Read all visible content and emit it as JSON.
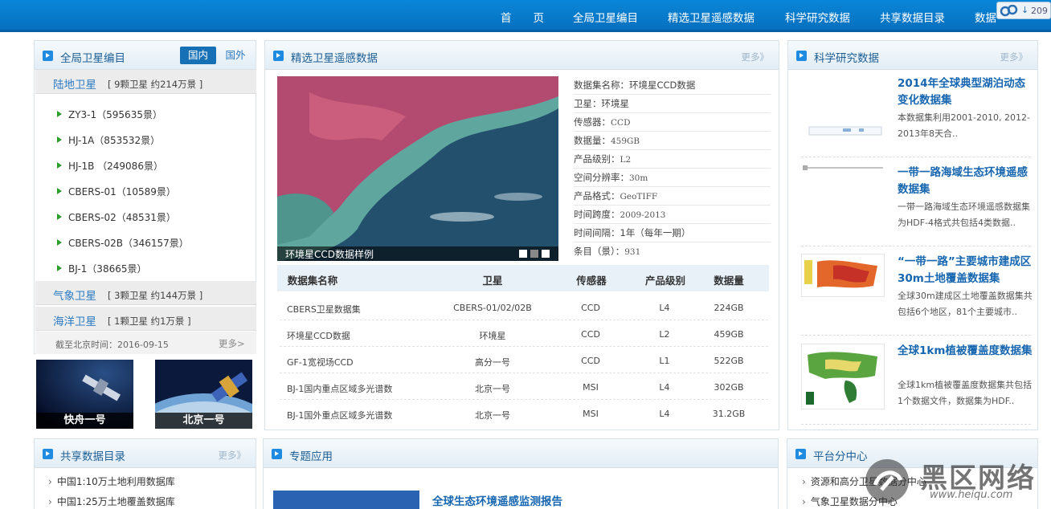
{
  "nav": {
    "items": [
      "首　　页",
      "全局卫星编目",
      "精选卫星遥感数据",
      "科学研究数据",
      "共享数据目录",
      "数据"
    ],
    "counter": "209"
  },
  "global_catalog": {
    "title": "全局卫星编目",
    "tabs": [
      "国内",
      "国外"
    ],
    "land": {
      "name": "陆地卫星",
      "desc": "[ 9颗卫星 约214万景 ]"
    },
    "satellites": [
      "ZY3-1（595635景）",
      "HJ-1A（853532景）",
      "HJ-1B （249086景）",
      "CBERS-01（10589景）",
      "CBERS-02（48531景）",
      "CBERS-02B（346157景）",
      "BJ-1（38665景）"
    ],
    "weather": {
      "name": "气象卫星",
      "desc": "[ 3颗卫星 约144万景 ]"
    },
    "ocean": {
      "name": "海洋卫星",
      "desc": "[ 1颗卫星 约1万景 ]"
    },
    "deadline": "截至北京时间：2016-09-15",
    "more": "更多>"
  },
  "thumbs": [
    "快舟一号",
    "北京一号"
  ],
  "featured": {
    "title": "精选卫星遥感数据",
    "more": "更多》",
    "image_caption": "环境星CCD数据样例",
    "info": [
      [
        "数据集名称：",
        "环境星CCD数据"
      ],
      [
        "卫星：",
        "环境星"
      ],
      [
        "传感器：",
        "CCD"
      ],
      [
        "数据量：",
        "459GB"
      ],
      [
        "产品级别：",
        "L2"
      ],
      [
        "空间分辨率：",
        "30m"
      ],
      [
        "产品格式：",
        "GeoTIFF"
      ],
      [
        "时间跨度：",
        "2009-2013"
      ],
      [
        "时间间隔：",
        "1年（每年一期）"
      ],
      [
        "条目（景）：",
        "931"
      ]
    ],
    "table_headers": [
      "数据集名称",
      "卫星",
      "传感器",
      "产品级别",
      "数据量"
    ],
    "rows": [
      [
        "CBERS卫星数据集",
        "CBERS-01/02/02B",
        "CCD",
        "L4",
        "224GB"
      ],
      [
        "环境星CCD数据",
        "环境星",
        "CCD",
        "L2",
        "459GB"
      ],
      [
        "GF-1宽视场CCD",
        "高分一号",
        "CCD",
        "L1",
        "522GB"
      ],
      [
        "BJ-1国内重点区域多光谱数",
        "北京一号",
        "MSI",
        "L4",
        "302GB"
      ],
      [
        "BJ-1国外重点区域多光谱数",
        "北京一号",
        "MSI",
        "L4",
        "31.2GB"
      ]
    ]
  },
  "science": {
    "title": "科学研究数据",
    "more": "更多》",
    "items": [
      {
        "title": "2014年全球典型湖泊动态变化数据集",
        "desc": "本数据集利用2001-2010, 2012-2013年8天合.."
      },
      {
        "title": "一带一路海域生态环境遥感数据集",
        "desc": "一带一路海域生态环境遥感数据集为HDF-4格式共包括4类数据.."
      },
      {
        "title": "“一带一路”主要城市建成区30m土地覆盖数据集",
        "desc": "全球30m建成区土地覆盖数据集共包括6个地区，81个主要城市.."
      },
      {
        "title": "全球1km植被覆盖度数据集",
        "desc": "全球1km植被覆盖度数据集共包括1个数据文件，数据集为HDF.."
      }
    ]
  },
  "shared": {
    "title": "共享数据目录",
    "more": "更多》",
    "items": [
      "中国1:10万土地利用数据库",
      "中国1:25万土地覆盖数据库"
    ]
  },
  "topic": {
    "title": "专题应用",
    "report": "全球生态环境遥感监测报告"
  },
  "platform": {
    "title": "平台分中心",
    "items": [
      "资源和高分卫星数据分中心",
      "气象卫星数据分中心"
    ]
  },
  "watermark": {
    "name": "黑区网络",
    "url": "www.heiqu.com"
  }
}
